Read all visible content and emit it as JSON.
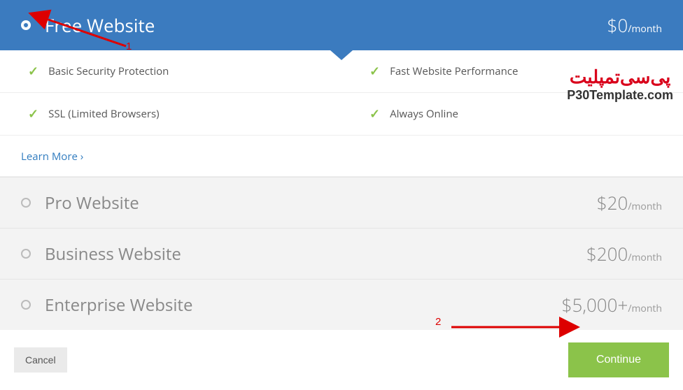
{
  "plans": [
    {
      "name": "Free Website",
      "price": "$0",
      "per": "/month",
      "selected": true
    },
    {
      "name": "Pro Website",
      "price": "$20",
      "per": "/month",
      "selected": false
    },
    {
      "name": "Business Website",
      "price": "$200",
      "per": "/month",
      "selected": false
    },
    {
      "name": "Enterprise Website",
      "price": "$5,000+",
      "per": "/month",
      "selected": false
    }
  ],
  "features": [
    "Basic Security Protection",
    "Fast Website Performance",
    "SSL (Limited Browsers)",
    "Always Online"
  ],
  "learn_more": "Learn More ›",
  "actions": {
    "cancel": "Cancel",
    "continue": "Continue"
  },
  "annotations": {
    "a1": "1",
    "a2": "2"
  },
  "watermark": {
    "brand": "پی‌سی‌تمپلیت",
    "domain": "P30Template.com"
  }
}
